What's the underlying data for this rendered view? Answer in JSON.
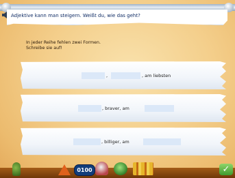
{
  "banner": {
    "text": "Adjektive kann man steigern. Weißt du, wie das geht?"
  },
  "instruction": {
    "line1": "In jeder Reihe fehlen zwei Formen.",
    "line2": "Schreibe sie auf!"
  },
  "rows": [
    {
      "sep": ",",
      "word": ", am liebsten"
    },
    {
      "word": ", braver, am"
    },
    {
      "word": ", billiger, am"
    }
  ],
  "toolbar": {
    "counter": "0100"
  }
}
